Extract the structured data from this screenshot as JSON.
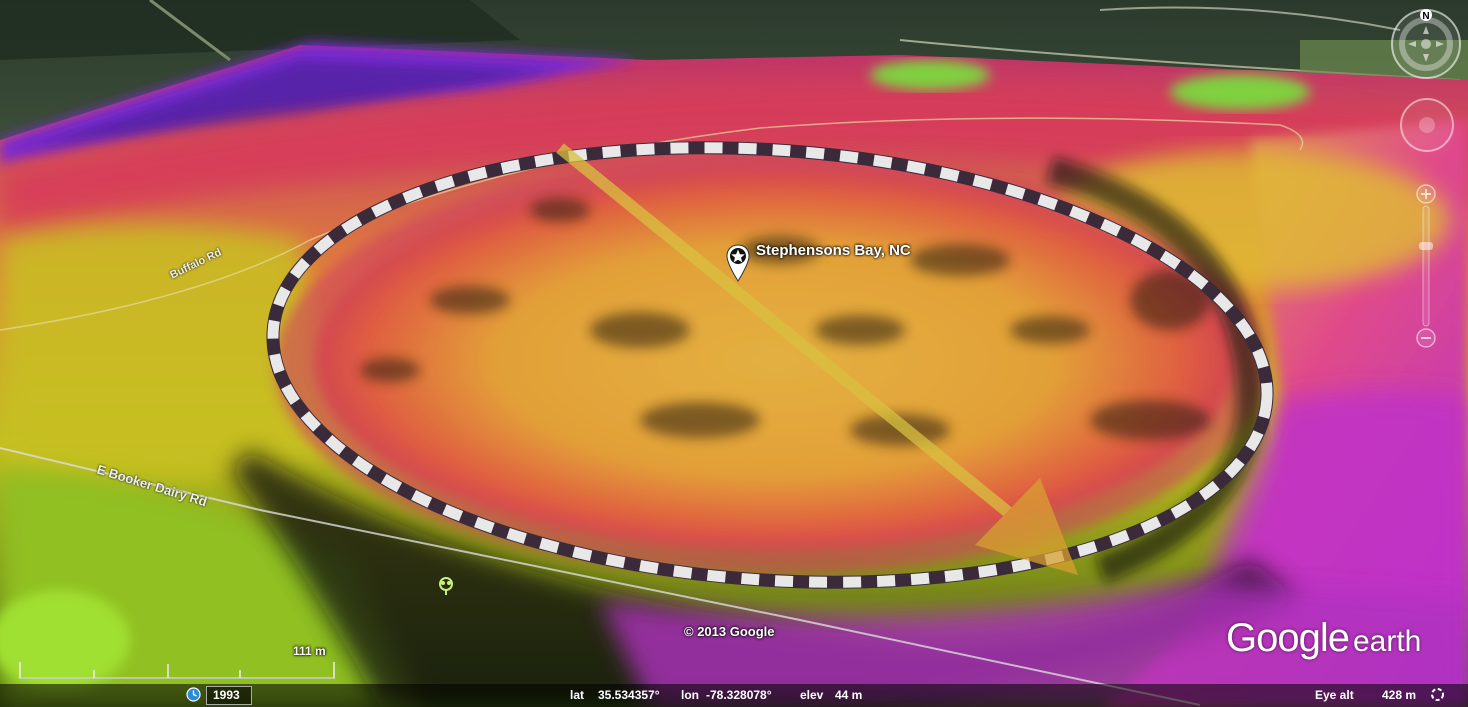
{
  "map": {
    "placemark_label": "Stephensons Bay, NC",
    "roads": [
      {
        "name": "Buffalo Rd"
      },
      {
        "name": "E Booker Dairy Rd"
      }
    ],
    "copyright": "© 2013 Google",
    "scale_label": "111 m",
    "historical_year": "1993",
    "logo": {
      "google": "Google",
      "earth": "earth"
    }
  },
  "status_bar": {
    "lat_label": "lat",
    "lat_value": "35.534357°",
    "lon_label": "lon",
    "lon_value": "-78.328078°",
    "elev_label": "elev",
    "elev_value": "44 m",
    "eye_alt_label": "Eye alt",
    "eye_alt_value": "428 m"
  },
  "navigation": {
    "compass_letter": "N"
  },
  "colors": {
    "ring_dash_light": "#e8e8e8",
    "ring_dash_dark": "#3a2a3a",
    "arrow": "#d8c040",
    "terrain_top": "#8a2aa0",
    "terrain_mid": "#e04a60",
    "terrain_center": "#e8a830",
    "terrain_low": "#b0d020",
    "terrain_edge": "#c030c8"
  },
  "icons": [
    "placemark-star-icon",
    "tree-icon",
    "compass-icon",
    "look-joystick-icon",
    "zoom-slider-icon",
    "clock-icon",
    "loading-spinner-icon"
  ]
}
